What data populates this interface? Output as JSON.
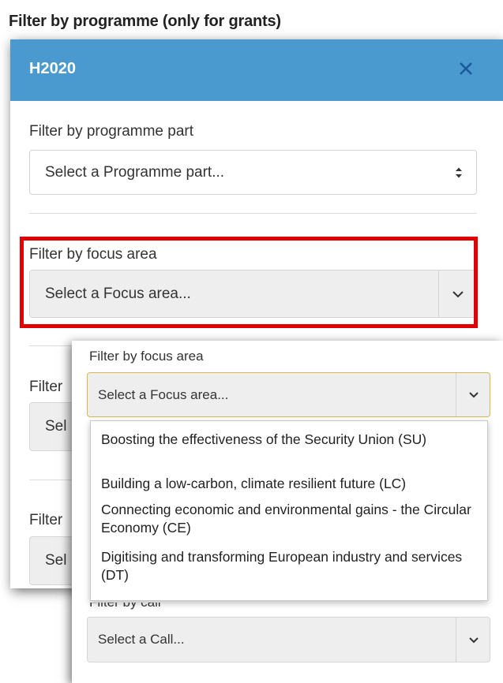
{
  "heading": "Filter by programme (only for grants)",
  "panel": {
    "title": "H2020",
    "close_icon": "close-icon",
    "accent_color": "#4a9acf"
  },
  "back": {
    "programme_part_label": "Filter by programme part",
    "programme_part_placeholder": "Select a Programme part...",
    "focus_area_label": "Filter by focus area",
    "focus_area_placeholder": "Select a Focus area...",
    "filter3_label_partial": "Filter",
    "filter3_select_partial": "Sel",
    "filter4_label_partial": "Filter",
    "filter4_select_partial": "Sel"
  },
  "front": {
    "focus_area_label": "Filter by focus area",
    "focus_area_placeholder": "Select a Focus area...",
    "options": [
      "Boosting the effectiveness of the Security Union (SU)",
      "Building a low-carbon, climate resilient future (LC)",
      "Connecting economic and environmental gains - the Circular Economy (CE)",
      "Digitising and transforming European industry and services (DT)"
    ],
    "call_label": "Filter by call",
    "call_placeholder": "Select a Call..."
  },
  "highlight_color": "#e00000"
}
